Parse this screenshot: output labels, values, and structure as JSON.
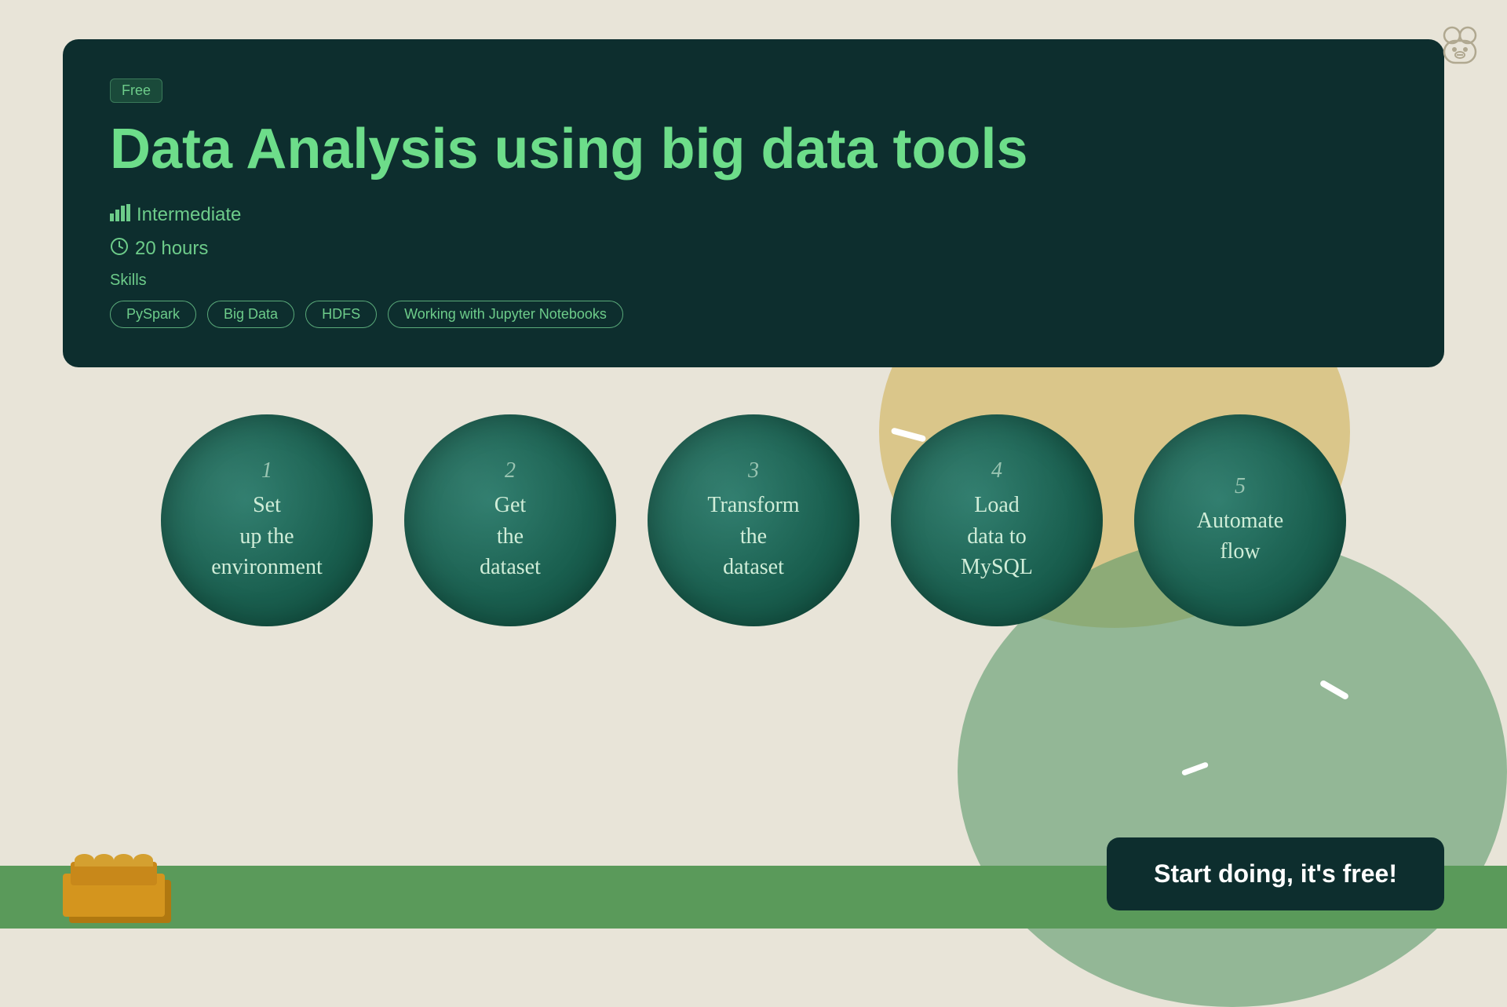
{
  "badge": {
    "label": "Free"
  },
  "course": {
    "title": "Data Analysis using big data tools",
    "level": "Intermediate",
    "duration": "20 hours",
    "skills_label": "Skills",
    "skills": [
      "PySpark",
      "Big Data",
      "HDFS",
      "Working with Jupyter Notebooks"
    ]
  },
  "steps": [
    {
      "number": "1",
      "text": "Set\nup the\nenvironment"
    },
    {
      "number": "2",
      "text": "Get\nthe\ndataset"
    },
    {
      "number": "3",
      "text": "Transform\nthe\ndataset"
    },
    {
      "number": "4",
      "text": "Load\ndata to\nMySQL"
    },
    {
      "number": "5",
      "text": "Automate\nflow"
    }
  ],
  "cta": {
    "label": "Start doing, it's free!"
  },
  "icons": {
    "level_icon": "📊",
    "time_icon": "🕐",
    "bear_icon": "🐻"
  }
}
